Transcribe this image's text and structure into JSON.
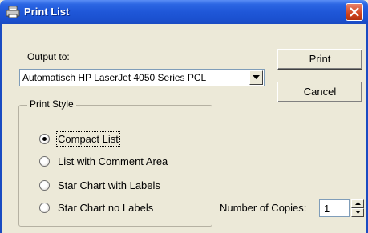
{
  "window": {
    "title": "Print List",
    "titlebar_color": "#1f57d8",
    "icon": "printer-icon"
  },
  "output": {
    "label": "Output to:",
    "printer_selected": "Automatisch HP LaserJet 4050 Series PCL"
  },
  "buttons": {
    "print": "Print",
    "cancel": "Cancel"
  },
  "print_style": {
    "title": "Print Style",
    "options": [
      {
        "label": "Compact List",
        "selected": true
      },
      {
        "label": "List with Comment Area",
        "selected": false
      },
      {
        "label": "Star Chart with Labels",
        "selected": false
      },
      {
        "label": "Star Chart no Labels",
        "selected": false
      }
    ]
  },
  "copies": {
    "label": "Number of Copies:",
    "value": "1"
  }
}
